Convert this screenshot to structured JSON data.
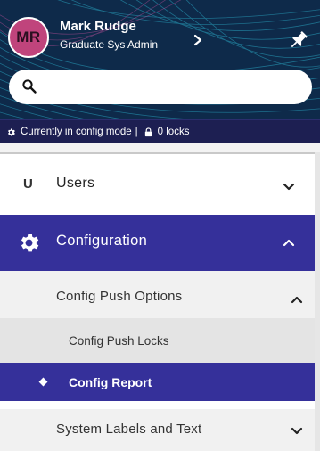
{
  "user": {
    "initials": "MR",
    "name": "Mark Rudge",
    "role": "Graduate Sys Admin"
  },
  "search": {
    "placeholder": "",
    "value": ""
  },
  "status": {
    "mode_text": "Currently in config mode",
    "separator": "|",
    "locks_text": "0 locks"
  },
  "menu": {
    "users": {
      "letter": "U",
      "label": "Users",
      "state": "collapsed"
    },
    "configuration": {
      "label": "Configuration",
      "state": "expanded",
      "children": {
        "push_options": {
          "label": "Config Push Options",
          "state": "expanded"
        },
        "push_locks": {
          "label": "Config Push Locks"
        },
        "report": {
          "label": "Config Report",
          "active": true
        },
        "labels_text": {
          "label": "System Labels and Text",
          "state": "collapsed"
        }
      }
    }
  },
  "colors": {
    "header_bg": "#0e2a4a",
    "header_lines": "#2aa8c4",
    "accent": "#35309a",
    "status_bar": "#1d1f52",
    "avatar_bg": "#c0447c"
  },
  "icons": [
    "gear-icon",
    "lock-icon",
    "search-icon",
    "pin-icon",
    "chevron-right-icon",
    "chevron-down-icon",
    "chevron-up-icon",
    "diamond-bullet-icon"
  ]
}
